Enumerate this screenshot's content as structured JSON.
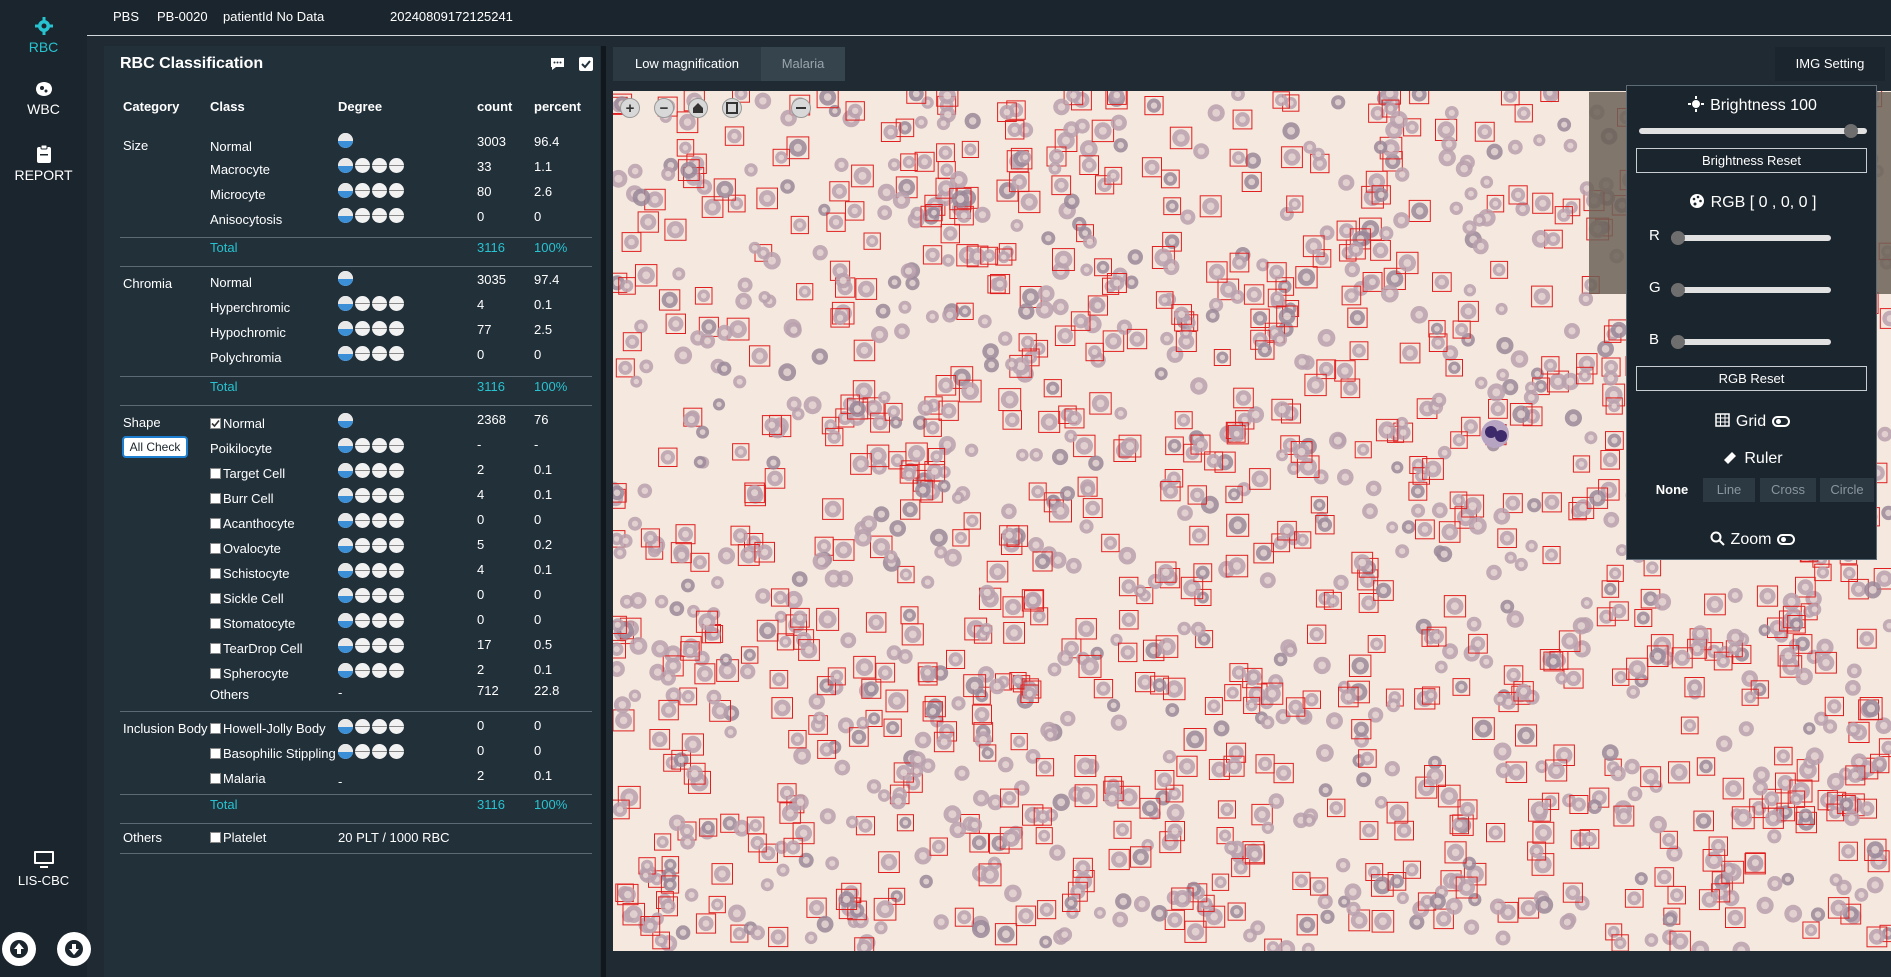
{
  "nav": {
    "items": [
      {
        "label": "RBC",
        "icon": "gear-icon"
      },
      {
        "label": "WBC",
        "icon": "cell-icon"
      },
      {
        "label": "REPORT",
        "icon": "clipboard-icon"
      }
    ],
    "lis_label": "LIS-CBC",
    "lis_icon": "monitor-icon",
    "upload_icon": "upload-icon",
    "download_icon": "download-icon"
  },
  "topbar": {
    "type": "PBS",
    "id": "PB-0020",
    "patient": "patientId No Data",
    "timestamp": "20240809172125241"
  },
  "panel": {
    "title": "RBC Classification",
    "headers": {
      "category": "Category",
      "class": "Class",
      "degree": "Degree",
      "count": "count",
      "percent": "percent"
    },
    "size": {
      "category": "Size",
      "rows": [
        {
          "class": "Normal",
          "count": "3003",
          "percent": "96.4"
        },
        {
          "class": "Macrocyte",
          "count": "33",
          "percent": "1.1"
        },
        {
          "class": "Microcyte",
          "count": "80",
          "percent": "2.6"
        },
        {
          "class": "Anisocytosis",
          "count": "0",
          "percent": "0"
        }
      ],
      "total": {
        "label": "Total",
        "count": "3116",
        "percent": "100%"
      }
    },
    "chromia": {
      "category": "Chromia",
      "rows": [
        {
          "class": "Normal",
          "count": "3035",
          "percent": "97.4"
        },
        {
          "class": "Hyperchromic",
          "count": "4",
          "percent": "0.1"
        },
        {
          "class": "Hypochromic",
          "count": "77",
          "percent": "2.5"
        },
        {
          "class": "Polychromia",
          "count": "0",
          "percent": "0"
        }
      ],
      "total": {
        "label": "Total",
        "count": "3116",
        "percent": "100%"
      }
    },
    "shape": {
      "category": "Shape",
      "all_check": "All Check",
      "rows": [
        {
          "class": "Normal",
          "count": "2368",
          "percent": "76"
        },
        {
          "class": "Poikilocyte",
          "count": "-",
          "percent": "-"
        },
        {
          "class": "Target Cell",
          "count": "2",
          "percent": "0.1"
        },
        {
          "class": "Burr Cell",
          "count": "4",
          "percent": "0.1"
        },
        {
          "class": "Acanthocyte",
          "count": "0",
          "percent": "0"
        },
        {
          "class": "Ovalocyte",
          "count": "5",
          "percent": "0.2"
        },
        {
          "class": "Schistocyte",
          "count": "4",
          "percent": "0.1"
        },
        {
          "class": "Sickle Cell",
          "count": "0",
          "percent": "0"
        },
        {
          "class": "Stomatocyte",
          "count": "0",
          "percent": "0"
        },
        {
          "class": "TearDrop Cell",
          "count": "17",
          "percent": "0.5"
        },
        {
          "class": "Spherocyte",
          "count": "2",
          "percent": "0.1"
        },
        {
          "class": "Others",
          "degree": "-",
          "count": "712",
          "percent": "22.8"
        }
      ]
    },
    "inclusion": {
      "category": "Inclusion Body",
      "rows": [
        {
          "class": "Howell-Jolly Body",
          "count": "0",
          "percent": "0"
        },
        {
          "class": "Basophilic Stippling",
          "count": "0",
          "percent": "0"
        },
        {
          "class": "Malaria",
          "degree": "-",
          "count": "2",
          "percent": "0.1"
        }
      ],
      "total": {
        "label": "Total",
        "count": "3116",
        "percent": "100%"
      }
    },
    "others": {
      "category": "Others",
      "class": "Platelet",
      "value": "20 PLT / 1000 RBC"
    }
  },
  "viewer": {
    "tabs": [
      "Low magnification",
      "Malaria"
    ],
    "img_setting": "IMG Setting",
    "tools": [
      "+",
      "−"
    ]
  },
  "settings": {
    "brightness_label": "Brightness 100",
    "brightness_value": 100,
    "brightness_reset": "Brightness Reset",
    "rgb_label": "RGB [ 0 , 0, 0 ]",
    "r": "R",
    "g": "G",
    "b": "B",
    "rgb_reset": "RGB Reset",
    "grid_label": "Grid",
    "ruler_label": "Ruler",
    "ruler_options": [
      "None",
      "Line",
      "Cross",
      "Circle"
    ],
    "zoom_label": "Zoom"
  },
  "colors": {
    "accent": "#27c3d0",
    "box": "#e02020",
    "bg": "#1f2a33"
  }
}
